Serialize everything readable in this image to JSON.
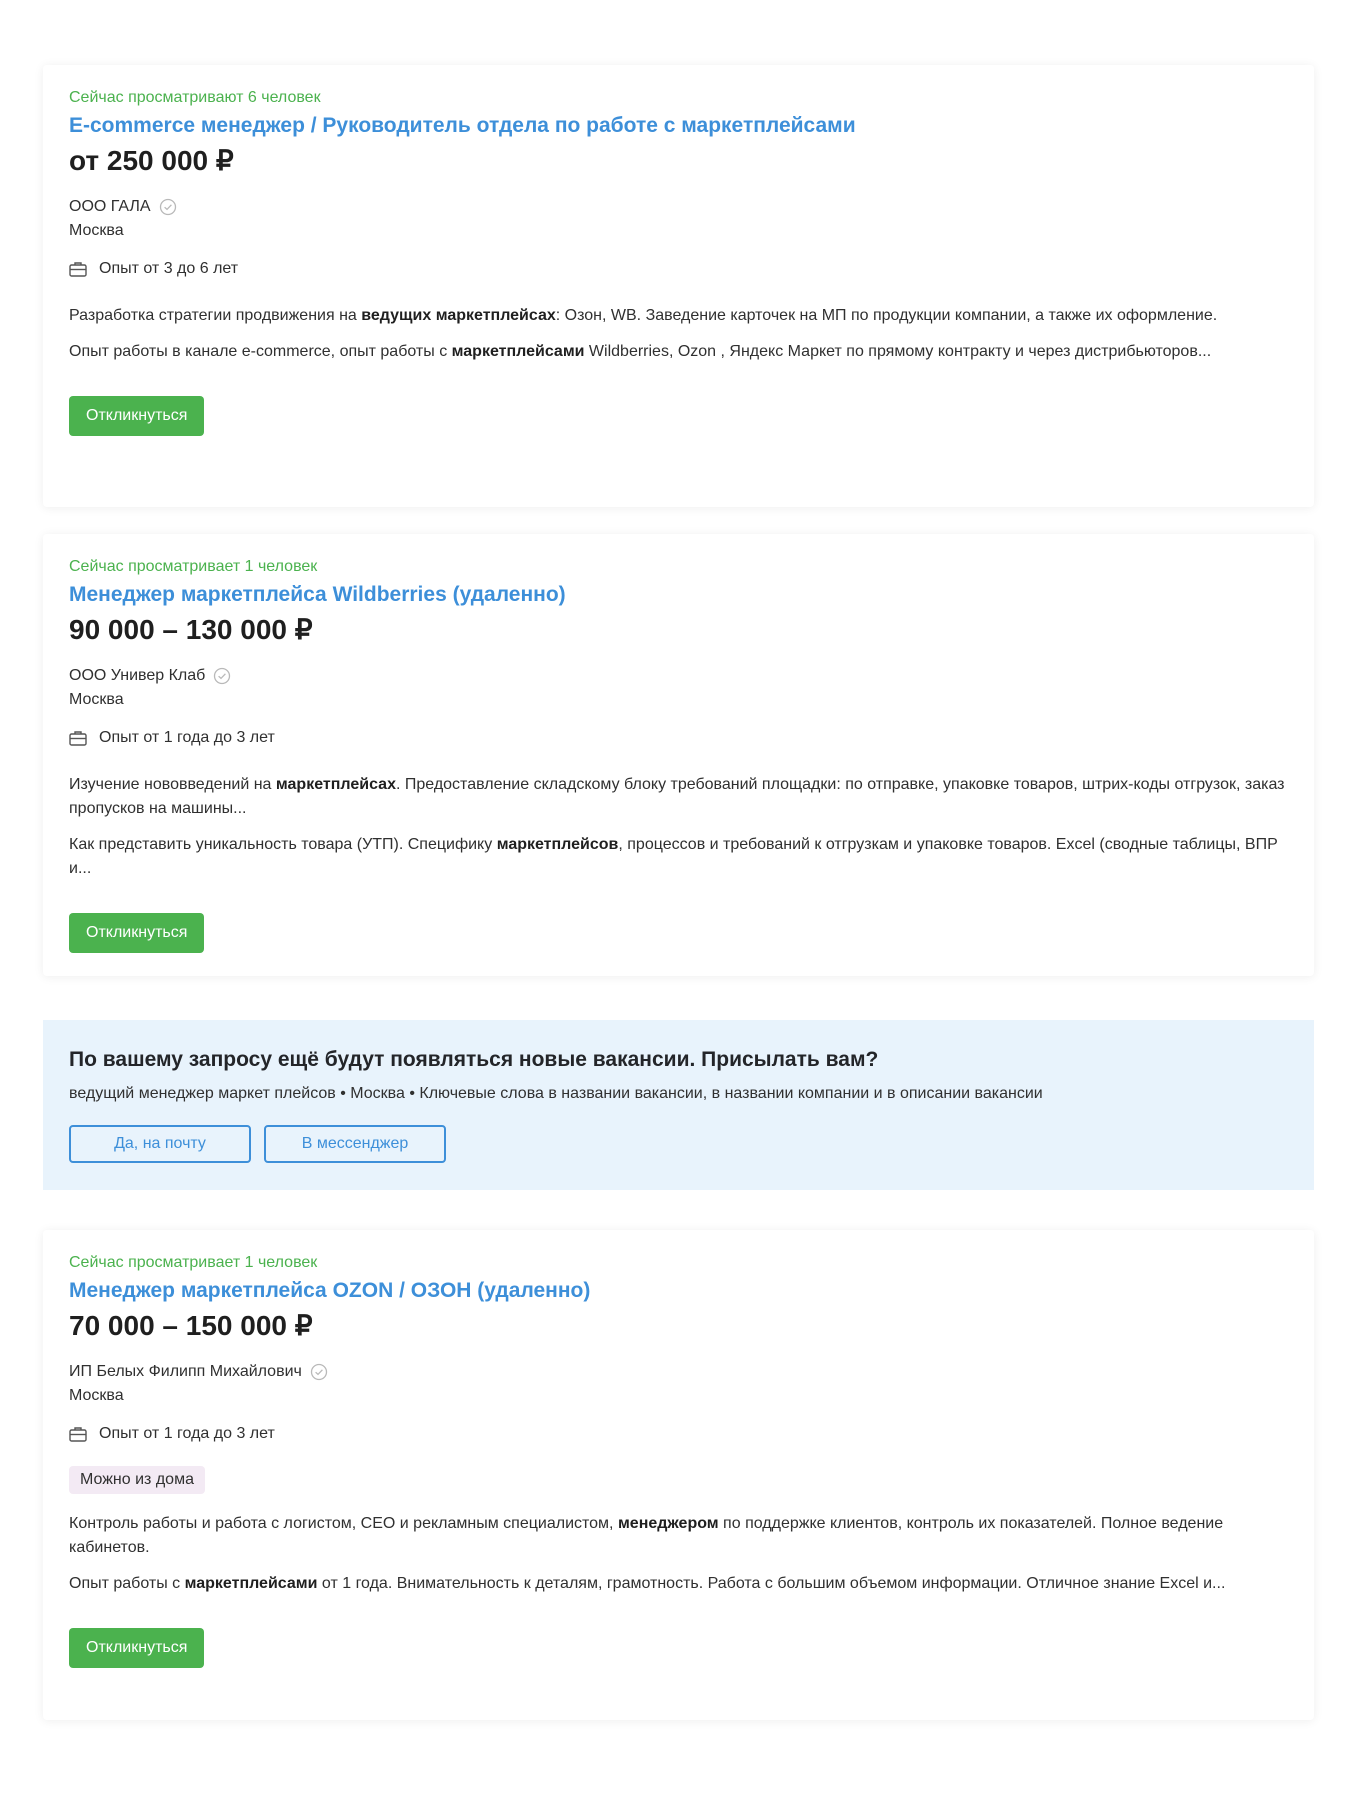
{
  "vacancies": [
    {
      "watchers": "Сейчас просматривают 6 человек",
      "title": "E-commerce менеджер / Руководитель отдела по работе с маркетплейсами",
      "salary": "от 250 000 ₽",
      "company": "ООО ГАЛА",
      "city": "Москва",
      "experience": "Опыт от 3 до 6 лет",
      "badge": "",
      "desc1": [
        {
          "text": "Разработка стратегии продвижения на ",
          "bold": false
        },
        {
          "text": "ведущих маркетплейсах",
          "bold": true
        },
        {
          "text": ": Озон, WB. Заведение карточек на МП по продукции компании, а также их оформление.",
          "bold": false
        }
      ],
      "desc2": [
        {
          "text": "Опыт работы в канале e-commerce, опыт работы с ",
          "bold": false
        },
        {
          "text": "маркетплейсами",
          "bold": true
        },
        {
          "text": " Wildberries, Ozon , Яндекс Маркет по прямому контракту и через дистрибьюторов...",
          "bold": false
        }
      ],
      "button": "Откликнуться"
    },
    {
      "watchers": "Сейчас просматривает 1 человек",
      "title": "Менеджер маркетплейса Wildberries (удаленно)",
      "salary": "90 000 – 130 000 ₽",
      "company": "ООО Универ Клаб",
      "city": "Москва",
      "experience": "Опыт от 1 года до 3 лет",
      "badge": "",
      "desc1": [
        {
          "text": "Изучение нововведений на ",
          "bold": false
        },
        {
          "text": "маркетплейсах",
          "bold": true
        },
        {
          "text": ". Предоставление складскому блоку требований площадки: по отправке, упаковке товаров, штрих-коды отгрузок, заказ пропусков на машины...",
          "bold": false
        }
      ],
      "desc2": [
        {
          "text": "Как представить уникальность товара (УТП). Специфику ",
          "bold": false
        },
        {
          "text": "маркетплейсов",
          "bold": true
        },
        {
          "text": ", процессов и требований к отгрузкам и упаковке товаров. Excel (сводные таблицы, ВПР и...",
          "bold": false
        }
      ],
      "button": "Откликнуться"
    },
    {
      "watchers": "Сейчас просматривает 1 человек",
      "title": "Менеджер маркетплейса OZON / ОЗОН (удаленно)",
      "salary": "70 000 – 150 000 ₽",
      "company": "ИП Белых Филипп Михайлович",
      "city": "Москва",
      "experience": "Опыт от 1 года до 3 лет",
      "badge": "Можно из дома",
      "desc1": [
        {
          "text": "Контроль работы и работа с логистом, СЕО и рекламным специалистом, ",
          "bold": false
        },
        {
          "text": "менеджером",
          "bold": true
        },
        {
          "text": " по поддержке клиентов, контроль их показателей. Полное ведение кабинетов.",
          "bold": false
        }
      ],
      "desc2": [
        {
          "text": "Опыт работы с ",
          "bold": false
        },
        {
          "text": "маркетплейсами",
          "bold": true
        },
        {
          "text": " от 1 года. Внимательность к деталям, грамотность. Работа с большим объемом информации. Отличное знание Excel и...",
          "bold": false
        }
      ],
      "button": "Откликнуться"
    }
  ],
  "subscribe": {
    "title": "По вашему запросу ещё будут появляться новые вакансии. Присылать вам?",
    "query": "ведущий менеджер маркет плейсов • Москва • Ключевые слова в названии вакансии, в названии компании и в описании вакансии",
    "email_button": "Да, на почту",
    "messenger_button": "В мессенджер"
  },
  "colors": {
    "accent_blue": "#3d8fd9",
    "accent_green": "#4bb24e",
    "subscribe_bg": "#e8f3fc",
    "badge_bg": "#f3eaf4"
  },
  "icons": {
    "verified": "check-circle-icon",
    "experience": "briefcase-icon"
  }
}
